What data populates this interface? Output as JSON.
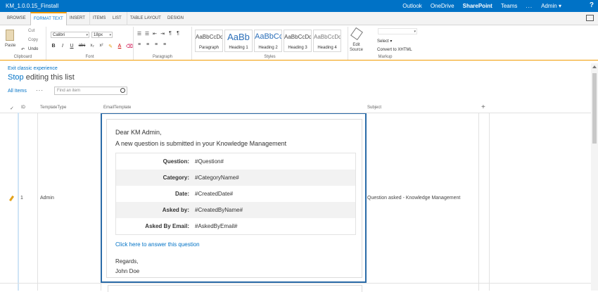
{
  "suitebar": {
    "title": "KM_1.0.0.15_Finstall",
    "links": [
      "Outlook",
      "OneDrive",
      "SharePoint",
      "Teams"
    ],
    "more": "...",
    "user": "Admin ▾",
    "help": "?"
  },
  "ribbon_tabs": {
    "browse": "BROWSE",
    "format_text": "FORMAT TEXT",
    "insert": "INSERT",
    "items": "ITEMS",
    "list": "LIST",
    "table_layout": "TABLE LAYOUT",
    "design": "DESIGN"
  },
  "clipboard": {
    "paste": "Paste",
    "cut": "Cut",
    "copy": "Copy",
    "undo": "Undo",
    "label": "Clipboard"
  },
  "font": {
    "family": "Calibri",
    "size": "18px",
    "label": "Font",
    "bold": "B",
    "italic": "I",
    "underline": "U",
    "strike": "abc",
    "subscript": "x₂",
    "superscript": "x²"
  },
  "paragraph": {
    "label": "Paragraph"
  },
  "styles": {
    "label": "Styles",
    "items": [
      {
        "sample": "AaBbCcDd",
        "name": "Paragraph"
      },
      {
        "sample": "AaBb",
        "name": "Heading 1"
      },
      {
        "sample": "AaBbCc",
        "name": "Heading 2"
      },
      {
        "sample": "AaBbCcDd",
        "name": "Heading 3"
      },
      {
        "sample": "AaBbCcDd",
        "name": "Heading 4"
      }
    ]
  },
  "markup": {
    "edit_source_1": "Edit",
    "edit_source_2": "Source",
    "select": "Select ▾",
    "convert": "Convert to XHTML",
    "label": "Markup"
  },
  "page": {
    "exit_classic": "Exit classic experience",
    "stop": "Stop",
    "stop_rest": " editing this list",
    "all_items": "All Items",
    "ellipsis": "···",
    "search_placeholder": "Find an item"
  },
  "columns": {
    "check": "✓",
    "id": "ID",
    "template_type": "TemplateType",
    "email_template": "EmailTemplate",
    "subject": "Subject",
    "add": "+"
  },
  "row": {
    "id": "1",
    "template_type": "Admin",
    "subject": "Question asked - Knowledge Management"
  },
  "email": {
    "greeting": "Dear KM Admin,",
    "intro": "A new question is submitted in your Knowledge Management",
    "fields": [
      {
        "label": "Question:",
        "value": "#Question#"
      },
      {
        "label": "Category:",
        "value": "#CategoryName#"
      },
      {
        "label": "Date:",
        "value": "#CreatedDate#"
      },
      {
        "label": "Asked by:",
        "value": "#CreatedByName#"
      },
      {
        "label": "Asked By Email:",
        "value": "#AskedByEmail#"
      }
    ],
    "link": "Click here to answer this question",
    "regards": "Regards,",
    "signature": "John Doe"
  },
  "colors": {
    "suitebar": "#0072c6",
    "accent_tab": "#f39b00",
    "link": "#0072c6",
    "editor_border": "#2a6ba8"
  }
}
